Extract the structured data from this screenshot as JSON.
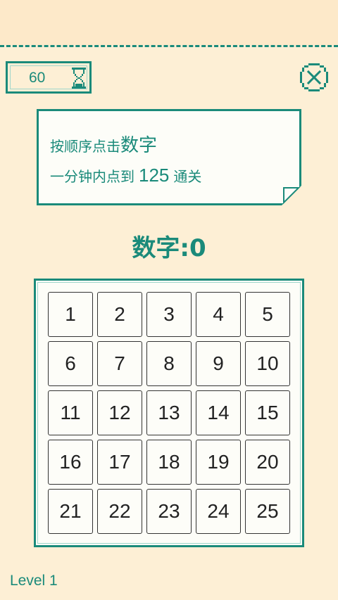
{
  "timer": {
    "value": "60",
    "icon": "hourglass-icon"
  },
  "close": {
    "icon": "close-icon"
  },
  "instructions": {
    "line1_prefix": "按顺序点击",
    "line1_emphasis": "数字",
    "line2_prefix": "一分钟内点到",
    "line2_target": "125",
    "line2_suffix": "通关"
  },
  "score": {
    "text": "数字:0"
  },
  "board": {
    "tiles": [
      "1",
      "2",
      "3",
      "4",
      "5",
      "6",
      "7",
      "8",
      "9",
      "10",
      "11",
      "12",
      "13",
      "14",
      "15",
      "16",
      "17",
      "18",
      "19",
      "20",
      "21",
      "22",
      "23",
      "24",
      "25"
    ]
  },
  "level": {
    "label": "Level 1"
  },
  "colors": {
    "accent": "#1a8a7a",
    "background": "#fdefd5",
    "tile_border": "#333333"
  }
}
